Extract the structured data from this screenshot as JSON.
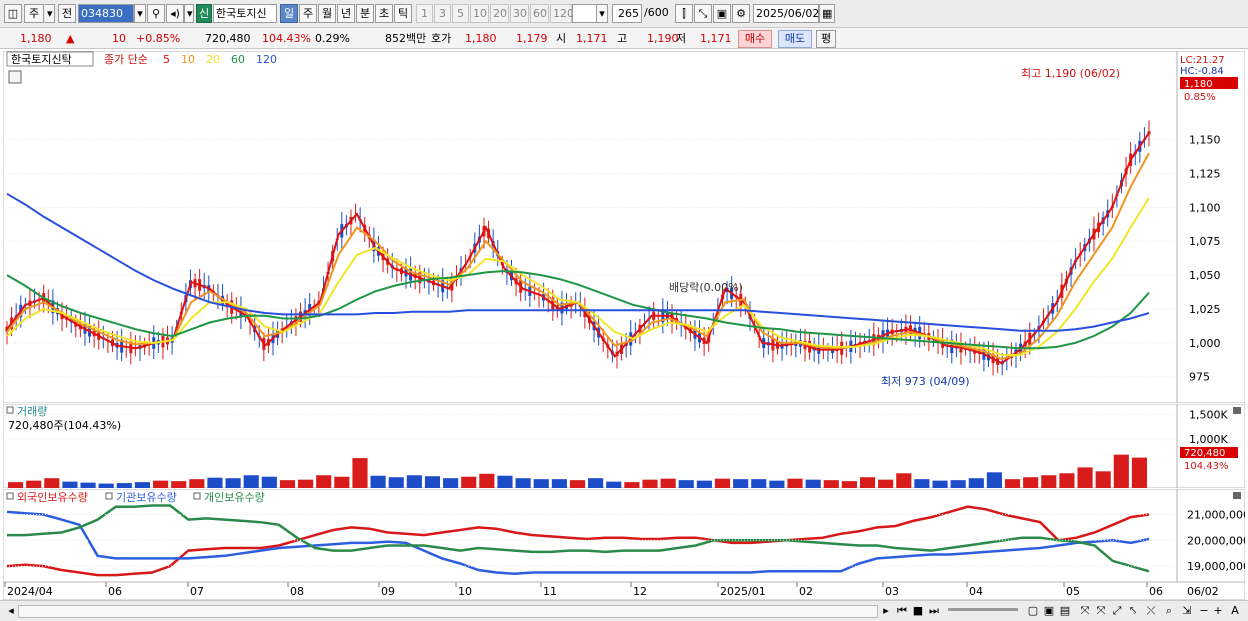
{
  "toolbar": {
    "period_unit": "주",
    "prev_label": "전",
    "stock_code": "034830",
    "new_badge": "신",
    "stock_name": "한국토지신",
    "periods": [
      "일",
      "주",
      "월",
      "년",
      "분",
      "초",
      "틱"
    ],
    "selected_period": "일",
    "intervals": [
      "1",
      "3",
      "5",
      "10",
      "20",
      "30",
      "60",
      "120"
    ],
    "count_current": "265",
    "count_total": "/600",
    "date": "2025/06/02"
  },
  "quote": {
    "price": "1,180",
    "change_arrow": "▲",
    "change": "10",
    "change_pct": "+0.85%",
    "volume": "720,480",
    "volume_ratio": "104.43%",
    "turnover_rate": "0.29%",
    "amount": "852백만",
    "bid_ask_label": "호가",
    "ask": "1,180",
    "bid": "1,179",
    "open_label": "시",
    "open": "1,171",
    "high_label": "고",
    "high": "1,190",
    "low_label": "저",
    "low": "1,171",
    "buy_label": "매수",
    "sell_label": "매도",
    "avg_label": "평"
  },
  "price_chart": {
    "legend_name": "한국토지신탁",
    "legend_ma_title": "종가 단순",
    "ma_periods": [
      "5",
      "10",
      "20",
      "60",
      "120"
    ],
    "colors": {
      "ma5": "#e01010",
      "ma10": "#f0961e",
      "ma20": "#f0e628",
      "ma60": "#1e9646",
      "ma120": "#2850dc",
      "up": "#d81c1c",
      "down": "#1c4cc8"
    },
    "lc_label": "LC:21.27",
    "hc_label": "HC:-0.84",
    "last_price_tag": "1,180",
    "last_pct_tag": "0.85%",
    "high_annotation": "최고 1,190 (06/02)",
    "low_annotation": "최저 973 (04/09)",
    "event_annotation": "배당락(0.00%)",
    "y_ticks": [
      "1,150",
      "1,125",
      "1,100",
      "1,075",
      "1,050",
      "1,025",
      "1,000",
      "975"
    ]
  },
  "volume_chart": {
    "title": "거래량",
    "value_label": "720,480주(104.43%)",
    "y_ticks": [
      "1,500K",
      "1,000K"
    ],
    "last_tag": "720,480",
    "last_pct_tag": "104.43%"
  },
  "holdings_chart": {
    "legend": [
      "외국인보유수량",
      "기관보유수량",
      "개인보유수량"
    ],
    "y_ticks": [
      "21,000,000",
      "20,000,000",
      "19,000,000"
    ]
  },
  "x_axis": {
    "labels": [
      "2024/04",
      "06",
      "07",
      "08",
      "09",
      "10",
      "11",
      "12",
      "2025/01",
      "02",
      "03",
      "04",
      "05",
      "06"
    ],
    "right_label": "06/02"
  },
  "chart_data": {
    "type": "line",
    "x_range": [
      "2024/04",
      "2025/06/02"
    ],
    "y_range": [
      963,
      1205
    ],
    "series": [
      {
        "name": "5",
        "values": [
          1010,
          1028,
          1033,
          1020,
          1012,
          1005,
          998,
          996,
          1000,
          1002,
          1045,
          1040,
          1028,
          1020,
          998,
          1010,
          1020,
          1030,
          1080,
          1095,
          1070,
          1055,
          1050,
          1045,
          1040,
          1060,
          1085,
          1055,
          1040,
          1035,
          1025,
          1030,
          1010,
          990,
          1005,
          1020,
          1020,
          1010,
          1000,
          1040,
          1030,
          1000,
          998,
          1000,
          995,
          995,
          998,
          1002,
          1008,
          1010,
          1005,
          998,
          996,
          992,
          985,
          995,
          1010,
          1030,
          1060,
          1080,
          1100,
          1135,
          1155
        ]
      },
      {
        "name": "10",
        "values": [
          1008,
          1025,
          1030,
          1022,
          1014,
          1008,
          1002,
          999,
          1000,
          1002,
          1030,
          1038,
          1030,
          1022,
          1005,
          1008,
          1018,
          1028,
          1065,
          1085,
          1075,
          1060,
          1052,
          1048,
          1043,
          1055,
          1075,
          1060,
          1045,
          1038,
          1028,
          1030,
          1015,
          998,
          1002,
          1015,
          1018,
          1012,
          1005,
          1030,
          1032,
          1008,
          1000,
          1000,
          997,
          996,
          997,
          1000,
          1005,
          1008,
          1005,
          1000,
          997,
          994,
          988,
          992,
          1003,
          1020,
          1045,
          1065,
          1085,
          1115,
          1140
        ]
      },
      {
        "name": "20",
        "values": [
          1005,
          1018,
          1025,
          1022,
          1016,
          1010,
          1005,
          1001,
          1000,
          1002,
          1018,
          1030,
          1030,
          1025,
          1012,
          1008,
          1015,
          1022,
          1045,
          1065,
          1070,
          1062,
          1055,
          1050,
          1046,
          1050,
          1062,
          1060,
          1050,
          1042,
          1032,
          1030,
          1020,
          1008,
          1003,
          1010,
          1015,
          1013,
          1008,
          1020,
          1028,
          1012,
          1004,
          1001,
          998,
          997,
          997,
          999,
          1003,
          1006,
          1005,
          1002,
          999,
          996,
          991,
          991,
          997,
          1008,
          1025,
          1045,
          1062,
          1085,
          1107
        ]
      },
      {
        "name": "60",
        "values": [
          1050,
          1042,
          1033,
          1027,
          1022,
          1018,
          1014,
          1010,
          1007,
          1005,
          1010,
          1015,
          1018,
          1020,
          1020,
          1018,
          1018,
          1020,
          1025,
          1032,
          1038,
          1042,
          1045,
          1047,
          1048,
          1050,
          1052,
          1053,
          1052,
          1050,
          1047,
          1043,
          1038,
          1033,
          1028,
          1025,
          1022,
          1020,
          1018,
          1015,
          1013,
          1011,
          1010,
          1008,
          1007,
          1006,
          1005,
          1004,
          1003,
          1002,
          1001,
          1000,
          999,
          998,
          997,
          996,
          996,
          997,
          1000,
          1005,
          1012,
          1022,
          1037
        ]
      },
      {
        "name": "120",
        "values": [
          1110,
          1102,
          1093,
          1085,
          1077,
          1069,
          1061,
          1053,
          1046,
          1040,
          1035,
          1030,
          1027,
          1024,
          1022,
          1021,
          1021,
          1021,
          1021,
          1021,
          1022,
          1022,
          1023,
          1023,
          1023,
          1024,
          1024,
          1024,
          1024,
          1024,
          1024,
          1024,
          1024,
          1024,
          1024,
          1024,
          1024,
          1024,
          1024,
          1024,
          1024,
          1023,
          1022,
          1021,
          1020,
          1019,
          1018,
          1017,
          1016,
          1015,
          1014,
          1013,
          1012,
          1011,
          1010,
          1009,
          1009,
          1009,
          1010,
          1012,
          1015,
          1018,
          1022
        ]
      }
    ],
    "volume_values": [
      120,
      150,
      200,
      130,
      110,
      90,
      100,
      120,
      150,
      140,
      180,
      210,
      200,
      260,
      230,
      160,
      170,
      260,
      230,
      610,
      250,
      220,
      260,
      240,
      200,
      230,
      290,
      250,
      200,
      180,
      180,
      160,
      200,
      130,
      120,
      170,
      190,
      160,
      150,
      190,
      180,
      180,
      150,
      190,
      170,
      160,
      140,
      220,
      170,
      300,
      180,
      150,
      160,
      200,
      320,
      180,
      220,
      260,
      300,
      420,
      340,
      680,
      620
    ],
    "holdings": [
      {
        "name": "외국인보유수량",
        "color": "#d81818",
        "values": [
          19.0,
          19.05,
          19.0,
          18.85,
          18.75,
          18.65,
          18.65,
          18.7,
          18.75,
          19.0,
          19.6,
          19.65,
          19.7,
          19.7,
          19.7,
          19.8,
          20.0,
          20.2,
          20.4,
          20.5,
          20.45,
          20.3,
          20.25,
          20.2,
          20.3,
          20.4,
          20.5,
          20.45,
          20.3,
          20.2,
          20.15,
          20.1,
          20.05,
          20.1,
          20.1,
          20.05,
          20.05,
          20.1,
          20.1,
          20.0,
          19.9,
          19.9,
          19.95,
          20.0,
          20.05,
          20.1,
          20.25,
          20.35,
          20.5,
          20.55,
          20.75,
          20.9,
          21.1,
          21.3,
          21.2,
          21.0,
          20.85,
          20.7,
          20.0,
          20.1,
          20.3,
          20.6,
          20.9,
          21.0
        ]
      },
      {
        "name": "기관보유수량",
        "color": "#2d5ee0",
        "values": [
          21.1,
          21.05,
          21.0,
          20.8,
          20.6,
          19.4,
          19.3,
          19.3,
          19.3,
          19.3,
          19.3,
          19.35,
          19.4,
          19.5,
          19.6,
          19.7,
          19.75,
          19.8,
          19.85,
          19.9,
          19.9,
          19.95,
          19.9,
          19.6,
          19.3,
          19.1,
          18.85,
          18.75,
          18.7,
          18.75,
          18.75,
          18.75,
          18.75,
          18.75,
          18.75,
          18.75,
          18.75,
          18.75,
          18.75,
          18.75,
          18.75,
          18.75,
          18.8,
          18.8,
          18.8,
          18.8,
          18.8,
          19.1,
          19.3,
          19.35,
          19.4,
          19.45,
          19.45,
          19.5,
          19.55,
          19.6,
          19.65,
          19.7,
          19.8,
          19.9,
          19.95,
          20.0,
          19.9,
          20.05
        ]
      },
      {
        "name": "개인보유수량",
        "color": "#2a8a48",
        "values": [
          20.2,
          20.2,
          20.25,
          20.3,
          20.5,
          20.8,
          21.3,
          21.3,
          21.35,
          21.35,
          20.8,
          20.85,
          20.8,
          20.75,
          20.7,
          20.6,
          20.1,
          19.7,
          19.6,
          19.6,
          19.7,
          19.8,
          19.8,
          19.8,
          19.7,
          19.6,
          19.7,
          19.65,
          19.6,
          19.55,
          19.55,
          19.6,
          19.6,
          19.55,
          19.6,
          19.6,
          19.6,
          19.7,
          19.8,
          20.0,
          20.0,
          20.0,
          20.0,
          20.0,
          19.95,
          19.9,
          19.85,
          19.8,
          19.8,
          19.7,
          19.65,
          19.6,
          19.7,
          19.8,
          19.9,
          20.0,
          20.1,
          20.1,
          20.0,
          19.95,
          19.8,
          19.2,
          19.0,
          18.8
        ]
      }
    ]
  }
}
